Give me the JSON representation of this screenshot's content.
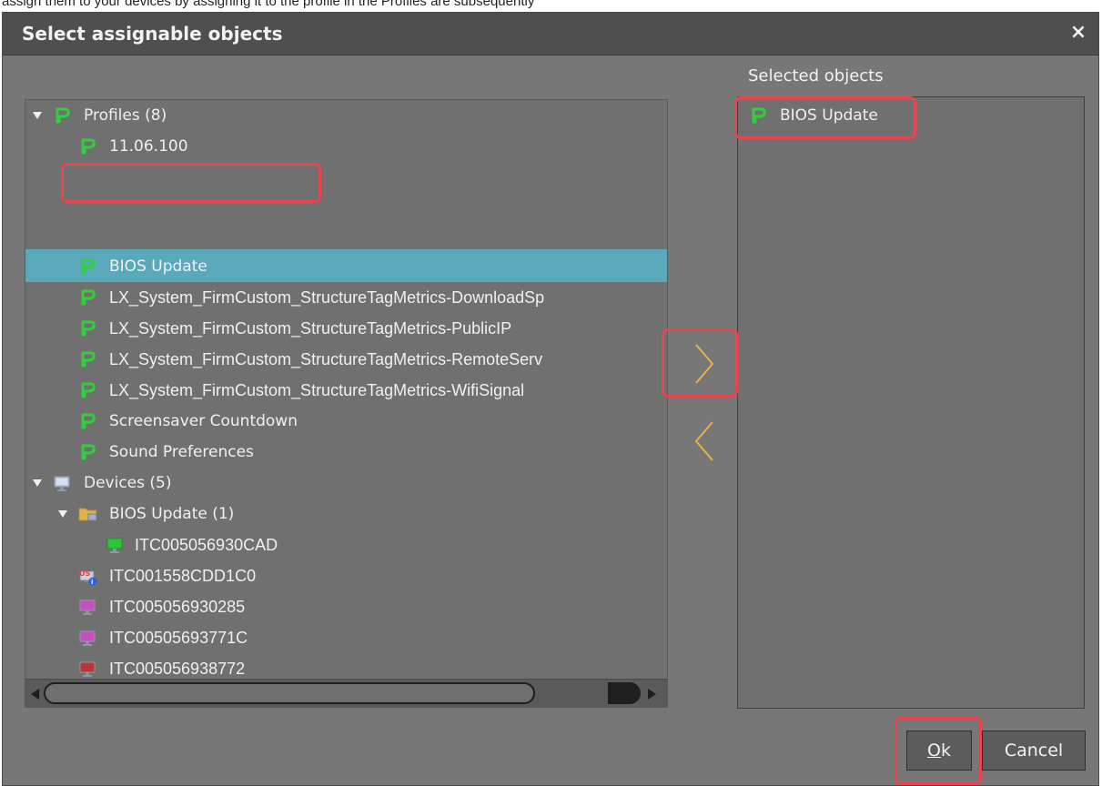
{
  "background_text": "assign them to your devices by assigning it to the profile in the Profiles are subsequently",
  "dialog": {
    "title": "Select assignable objects",
    "close_label": "×"
  },
  "tree": {
    "profiles_group": {
      "label": "Profiles (8)",
      "icon": "profile-icon"
    },
    "profiles": [
      {
        "label": "11.06.100",
        "icon": "profile-icon"
      },
      {
        "label": "BIOS Update",
        "icon": "profile-icon",
        "selected": true
      },
      {
        "label": "LX_System_FirmCustom_StructureTagMetrics-DownloadSp",
        "icon": "profile-icon"
      },
      {
        "label": "LX_System_FirmCustom_StructureTagMetrics-PublicIP",
        "icon": "profile-icon"
      },
      {
        "label": "LX_System_FirmCustom_StructureTagMetrics-RemoteServ",
        "icon": "profile-icon"
      },
      {
        "label": "LX_System_FirmCustom_StructureTagMetrics-WifiSignal",
        "icon": "profile-icon"
      },
      {
        "label": "Screensaver Countdown",
        "icon": "profile-icon"
      },
      {
        "label": "Sound Preferences",
        "icon": "profile-icon"
      }
    ],
    "devices_group": {
      "label": "Devices (5)",
      "icon": "computer-icon"
    },
    "device_folder": {
      "label": "BIOS Update (1)",
      "icon": "folder-icon"
    },
    "folder_devices": [
      {
        "label": "ITC005056930CAD",
        "icon": "device-green-icon"
      }
    ],
    "devices": [
      {
        "label": "ITC001558CDD1C0",
        "icon": "device-update-icon"
      },
      {
        "label": "ITC005056930285",
        "icon": "device-magenta-icon"
      },
      {
        "label": "ITC00505693771C",
        "icon": "device-magenta-icon"
      },
      {
        "label": "ITC005056938772",
        "icon": "device-red-icon"
      }
    ]
  },
  "selected_panel": {
    "label": "Selected objects",
    "items": [
      {
        "label": "BIOS Update",
        "icon": "profile-icon"
      }
    ]
  },
  "buttons": {
    "ok_mnemonic": "O",
    "ok_rest": "k",
    "cancel": "Cancel"
  },
  "colors": {
    "dialog_bg": "#777777",
    "titlebar_bg": "#4f4f4f",
    "panel_bg": "#707070",
    "selection": "#59a9bb",
    "profile_icon": "#2fd03a",
    "arrow_accent": "#e8b04a",
    "highlight": "#e8464c"
  }
}
